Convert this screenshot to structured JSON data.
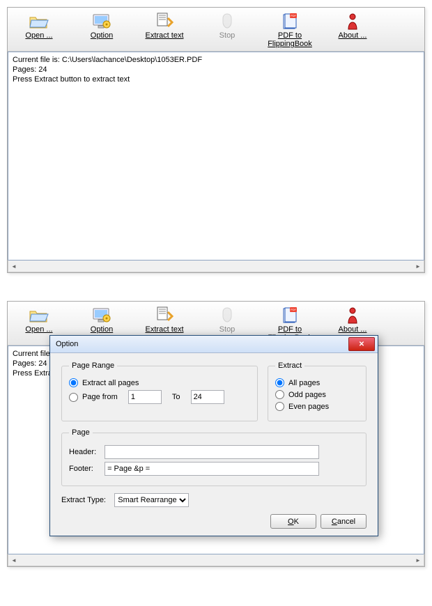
{
  "toolbar": {
    "open": "Open ...",
    "option": "Option",
    "extract": "Extract text",
    "stop": "Stop",
    "flip": "PDF to FlippingBook",
    "about": "About ..."
  },
  "status": {
    "line1": "Current file is: C:\\Users\\lachance\\Desktop\\1053ER.PDF",
    "line2": "Pages: 24",
    "line3": "Press Extract button to extract text",
    "line3b": "Press Extract b"
  },
  "dialog": {
    "title": "Option",
    "pageRange": {
      "legend": "Page Range",
      "optAll": "Extract all pages",
      "optFrom": "Page from",
      "from": "1",
      "toLabel": "To",
      "to": "24"
    },
    "extract": {
      "legend": "Extract",
      "all": "All pages",
      "odd": "Odd pages",
      "even": "Even pages"
    },
    "page": {
      "legend": "Page",
      "headerLabel": "Header:",
      "headerVal": "",
      "footerLabel": "Footer:",
      "footerVal": "= Page &p ="
    },
    "extractTypeLabel": "Extract Type:",
    "extractTypeVal": "Smart Rearrange",
    "ok": "OK",
    "cancel": "Cancel"
  }
}
